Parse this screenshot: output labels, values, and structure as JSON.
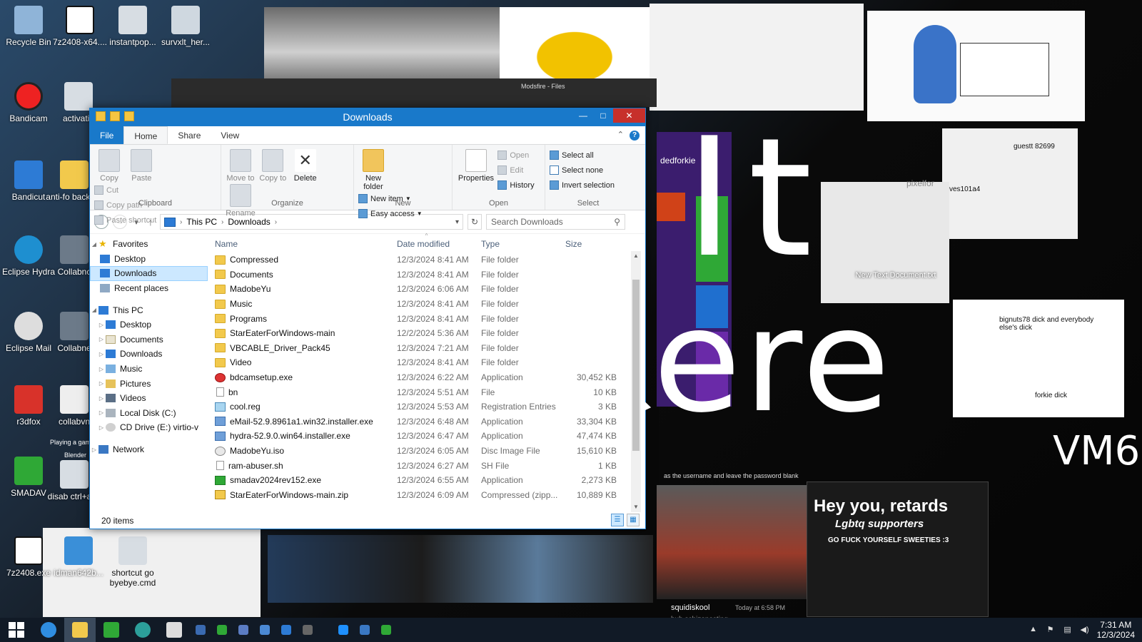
{
  "desktop": {
    "icons": [
      {
        "label": "Recycle Bin"
      },
      {
        "label": "7z2408-x64...."
      },
      {
        "label": "instantpop..."
      },
      {
        "label": "survxlt_her..."
      },
      {
        "label": "Bandicam"
      },
      {
        "label": "activatio"
      },
      {
        "label": "Bandicut"
      },
      {
        "label": "anti-fo backgro"
      },
      {
        "label": "Eclipse Hydra"
      },
      {
        "label": "Collabnc"
      },
      {
        "label": "Eclipse Mail"
      },
      {
        "label": "Collabne"
      },
      {
        "label": "r3dfox"
      },
      {
        "label": "collabvn"
      },
      {
        "label": "SMADAV"
      },
      {
        "label": "disab ctrl+alt+"
      },
      {
        "label": "7z2408.exe"
      },
      {
        "label": "idman642b..."
      },
      {
        "label": "shortcut go byebye.cmd"
      }
    ],
    "overlay_text": {
      "line1": "It",
      "line2": "ere",
      "vm": "VM6"
    },
    "bg_labels": {
      "new_text_document": "New Text Document.txt",
      "forkie": "dedforkie",
      "guest": "guestt 82699",
      "vm_user": "ves101a4",
      "drawing_note1": "bignuts78 dick and everybody else's dick",
      "drawing_note2": "forkie dick",
      "chat_title": "Hey you, retards",
      "chat_sub": "Lgbtq supporters",
      "chat_line": "GO FUCK YOURSELF SWEETIES :3",
      "discord_user": "squidiskool",
      "discord_time": "Today at 6:58 PM",
      "discord_status": "hub schizoposting",
      "password_hint": "as the username and leave the password blank",
      "browser_tab": "Modsfire - Files",
      "pixel_site": "pixelfor",
      "playing": "Playing a game",
      "blender": "Blender"
    }
  },
  "window": {
    "title": "Downloads",
    "buttons": {
      "minimize": "—",
      "maximize": "□",
      "close": "✕"
    },
    "tabs": {
      "file": "File",
      "home": "Home",
      "share": "Share",
      "view": "View"
    },
    "ribbon": {
      "clipboard": {
        "label": "Clipboard",
        "copy": "Copy",
        "paste": "Paste",
        "cut": "Cut",
        "copy_path": "Copy path",
        "paste_shortcut": "Paste shortcut"
      },
      "organize": {
        "label": "Organize",
        "move_to": "Move to",
        "copy_to": "Copy to",
        "delete": "Delete",
        "rename": "Rename"
      },
      "new": {
        "label": "New",
        "new_folder": "New folder",
        "new_item": "New item",
        "easy_access": "Easy access"
      },
      "open": {
        "label": "Open",
        "properties": "Properties",
        "open": "Open",
        "edit": "Edit",
        "history": "History"
      },
      "select": {
        "label": "Select",
        "select_all": "Select all",
        "select_none": "Select none",
        "invert_selection": "Invert selection"
      }
    },
    "address": {
      "root": "This PC",
      "current": "Downloads"
    },
    "search": {
      "placeholder": "Search Downloads"
    },
    "nav": {
      "favorites": "Favorites",
      "fav_items": [
        "Desktop",
        "Downloads",
        "Recent places"
      ],
      "this_pc": "This PC",
      "pc_items": [
        "Desktop",
        "Documents",
        "Downloads",
        "Music",
        "Pictures",
        "Videos",
        "Local Disk (C:)",
        "CD Drive (E:) virtio-v"
      ],
      "network": "Network"
    },
    "columns": {
      "name": "Name",
      "date": "Date modified",
      "type": "Type",
      "size": "Size"
    },
    "files": [
      {
        "name": "Compressed",
        "date": "12/3/2024 8:41 AM",
        "type": "File folder",
        "size": "",
        "icon": "folder"
      },
      {
        "name": "Documents",
        "date": "12/3/2024 8:41 AM",
        "type": "File folder",
        "size": "",
        "icon": "folder"
      },
      {
        "name": "MadobeYu",
        "date": "12/3/2024 6:06 AM",
        "type": "File folder",
        "size": "",
        "icon": "folder"
      },
      {
        "name": "Music",
        "date": "12/3/2024 8:41 AM",
        "type": "File folder",
        "size": "",
        "icon": "folder"
      },
      {
        "name": "Programs",
        "date": "12/3/2024 8:41 AM",
        "type": "File folder",
        "size": "",
        "icon": "folder"
      },
      {
        "name": "StarEaterForWindows-main",
        "date": "12/2/2024 5:36 AM",
        "type": "File folder",
        "size": "",
        "icon": "folder"
      },
      {
        "name": "VBCABLE_Driver_Pack45",
        "date": "12/3/2024 7:21 AM",
        "type": "File folder",
        "size": "",
        "icon": "folder"
      },
      {
        "name": "Video",
        "date": "12/3/2024 8:41 AM",
        "type": "File folder",
        "size": "",
        "icon": "folder"
      },
      {
        "name": "bdcamsetup.exe",
        "date": "12/3/2024 6:22 AM",
        "type": "Application",
        "size": "30,452 KB",
        "icon": "exe-red"
      },
      {
        "name": "bn",
        "date": "12/3/2024 5:51 AM",
        "type": "File",
        "size": "10 KB",
        "icon": "file"
      },
      {
        "name": "cool.reg",
        "date": "12/3/2024 5:53 AM",
        "type": "Registration Entries",
        "size": "3 KB",
        "icon": "reg"
      },
      {
        "name": "eMail-52.9.8961a1.win32.installer.exe",
        "date": "12/3/2024 6:48 AM",
        "type": "Application",
        "size": "33,304 KB",
        "icon": "app"
      },
      {
        "name": "hydra-52.9.0.win64.installer.exe",
        "date": "12/3/2024 6:47 AM",
        "type": "Application",
        "size": "47,474 KB",
        "icon": "app"
      },
      {
        "name": "MadobeYu.iso",
        "date": "12/3/2024 6:05 AM",
        "type": "Disc Image File",
        "size": "15,610 KB",
        "icon": "iso"
      },
      {
        "name": "ram-abuser.sh",
        "date": "12/3/2024 6:27 AM",
        "type": "SH File",
        "size": "1 KB",
        "icon": "file"
      },
      {
        "name": "smadav2024rev152.exe",
        "date": "12/3/2024 6:55 AM",
        "type": "Application",
        "size": "2,273 KB",
        "icon": "exe-green"
      },
      {
        "name": "StarEaterForWindows-main.zip",
        "date": "12/3/2024 6:09 AM",
        "type": "Compressed (zipp...",
        "size": "10,889 KB",
        "icon": "zip"
      }
    ],
    "status": "20 items"
  },
  "taskbar": {
    "time": "7:31 AM",
    "date": "12/3/2024"
  },
  "colors": {
    "accent": "#1979ca",
    "close": "#c7302b",
    "selection": "#cce8ff",
    "taskbar": "#111a26"
  }
}
